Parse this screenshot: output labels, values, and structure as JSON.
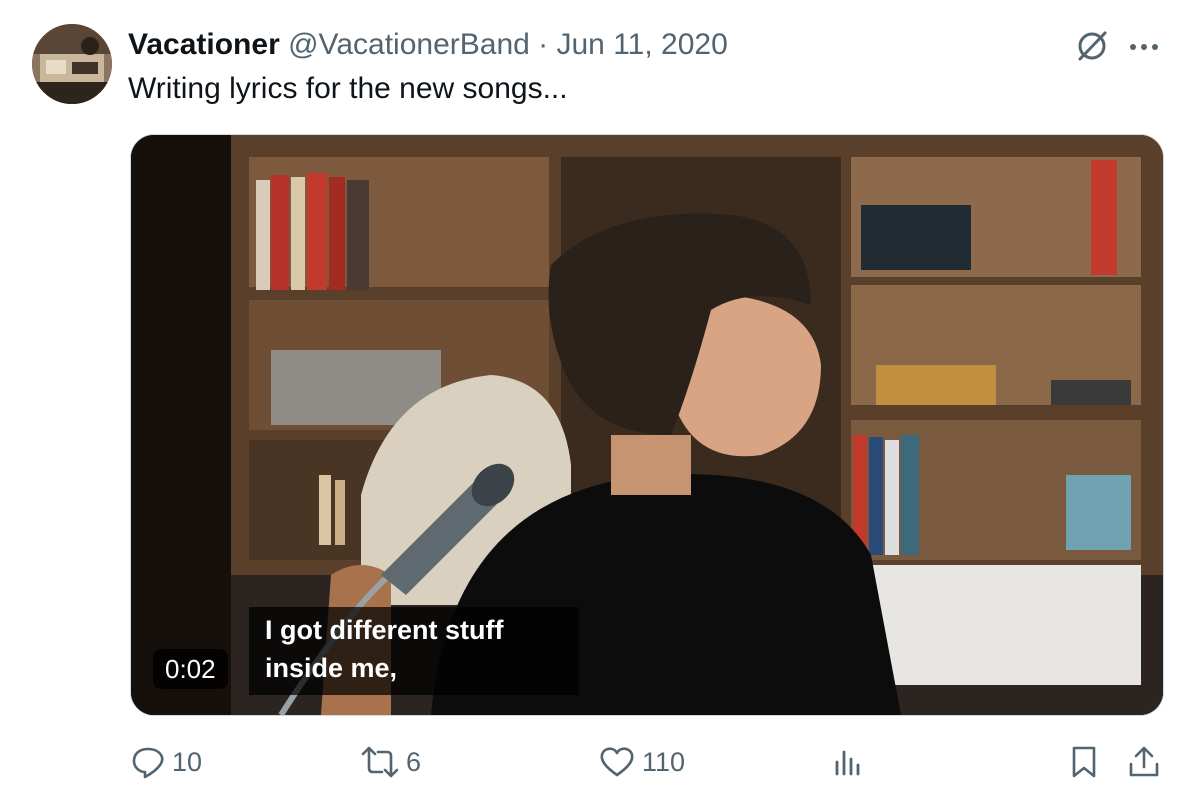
{
  "tweet": {
    "author_name": "Vacationer",
    "handle": "@VacationerBand",
    "separator": "·",
    "date": "Jun 11, 2020",
    "text": "Writing lyrics for the new songs..."
  },
  "top_icons": [
    "grok-icon",
    "more-icon"
  ],
  "media": {
    "timestamp": "0:02",
    "subtitle_lines": [
      "I got different stuff",
      "inside me,"
    ]
  },
  "actions": {
    "replies": "10",
    "reposts": "6",
    "likes": "110"
  },
  "colors": {
    "text": "#0f1419",
    "secondary": "#536471",
    "border": "#cfd9de"
  }
}
